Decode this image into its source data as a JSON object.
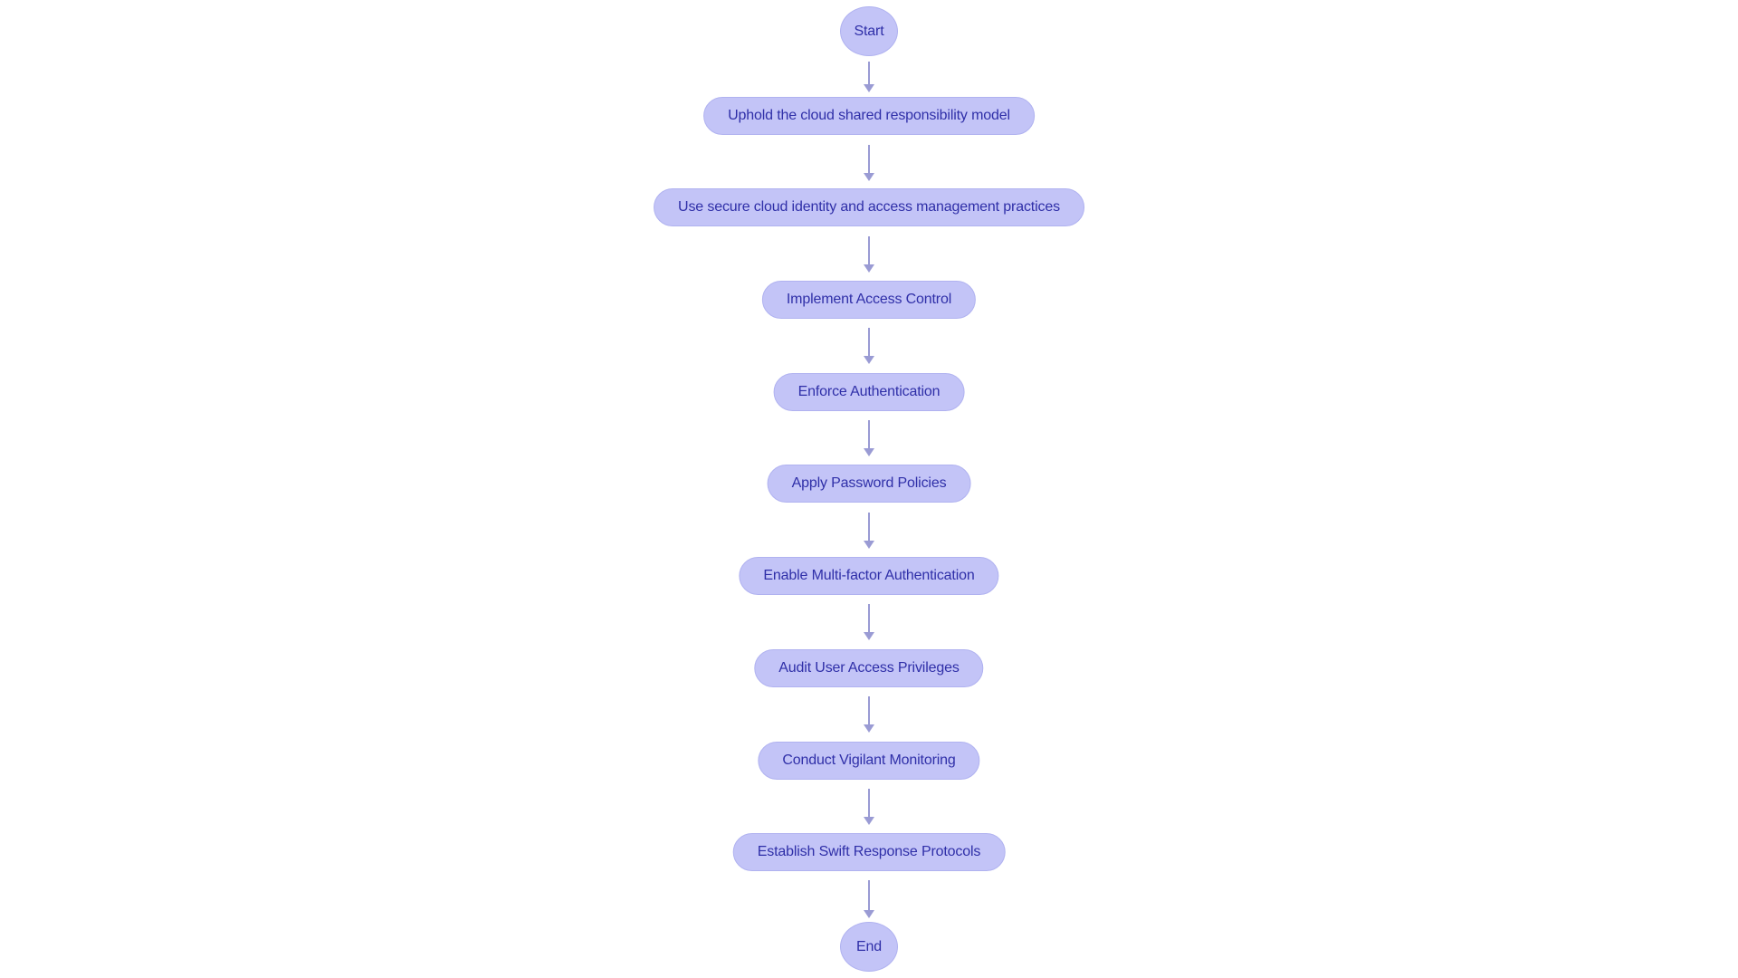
{
  "diagram": {
    "type": "flowchart",
    "orientation": "top-to-bottom",
    "background_color": "#ffffff",
    "node_fill_color": "#c3c4f7",
    "node_border_color": "#b0b2f0",
    "node_text_color": "#2f2fa8",
    "connector_color": "#9a9bd4",
    "nodes": [
      {
        "id": "start",
        "label": "Start",
        "shape": "ellipse"
      },
      {
        "id": "n1",
        "label": "Uphold the cloud shared responsibility model",
        "shape": "stadium"
      },
      {
        "id": "n2",
        "label": "Use secure cloud identity and access management practices",
        "shape": "stadium"
      },
      {
        "id": "n3",
        "label": "Implement Access Control",
        "shape": "stadium"
      },
      {
        "id": "n4",
        "label": "Enforce Authentication",
        "shape": "stadium"
      },
      {
        "id": "n5",
        "label": "Apply Password Policies",
        "shape": "stadium"
      },
      {
        "id": "n6",
        "label": "Enable Multi-factor Authentication",
        "shape": "stadium"
      },
      {
        "id": "n7",
        "label": "Audit User Access Privileges",
        "shape": "stadium"
      },
      {
        "id": "n8",
        "label": "Conduct Vigilant Monitoring",
        "shape": "stadium"
      },
      {
        "id": "n9",
        "label": "Establish Swift Response Protocols",
        "shape": "stadium"
      },
      {
        "id": "end",
        "label": "End",
        "shape": "ellipse"
      }
    ],
    "edges": [
      {
        "from": "start",
        "to": "n1"
      },
      {
        "from": "n1",
        "to": "n2"
      },
      {
        "from": "n2",
        "to": "n3"
      },
      {
        "from": "n3",
        "to": "n4"
      },
      {
        "from": "n4",
        "to": "n5"
      },
      {
        "from": "n5",
        "to": "n6"
      },
      {
        "from": "n6",
        "to": "n7"
      },
      {
        "from": "n7",
        "to": "n8"
      },
      {
        "from": "n8",
        "to": "n9"
      },
      {
        "from": "n9",
        "to": "end"
      }
    ]
  }
}
